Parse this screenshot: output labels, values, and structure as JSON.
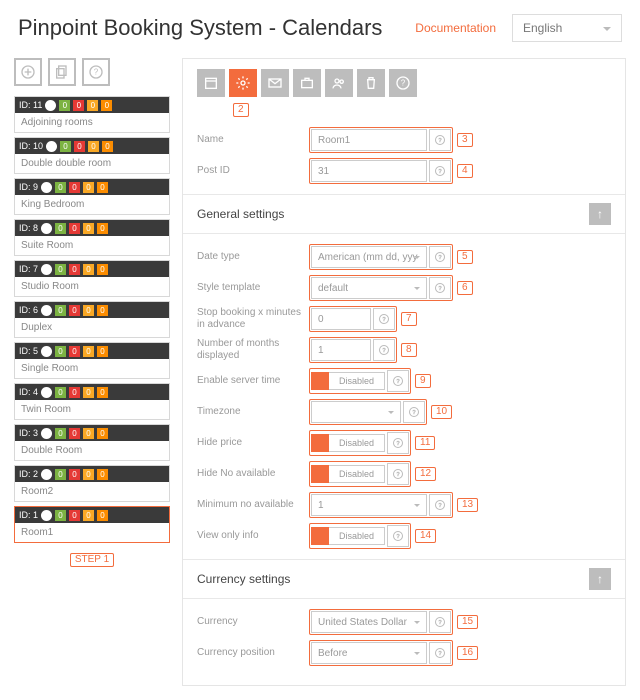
{
  "header": {
    "title": "Pinpoint Booking System - Calendars",
    "doc": "Documentation",
    "lang": "English"
  },
  "step1": "STEP 1",
  "toolbar_badge": "2",
  "calendars": [
    {
      "id": "ID: 11",
      "name": "Adjoining rooms"
    },
    {
      "id": "ID: 10",
      "name": "Double double room"
    },
    {
      "id": "ID: 9",
      "name": "King Bedroom"
    },
    {
      "id": "ID: 8",
      "name": "Suite Room"
    },
    {
      "id": "ID: 7",
      "name": "Studio Room"
    },
    {
      "id": "ID: 6",
      "name": "Duplex"
    },
    {
      "id": "ID: 5",
      "name": "Single Room"
    },
    {
      "id": "ID: 4",
      "name": "Twin Room"
    },
    {
      "id": "ID: 3",
      "name": "Double Room"
    },
    {
      "id": "ID: 2",
      "name": "Room2"
    },
    {
      "id": "ID: 1",
      "name": "Room1"
    }
  ],
  "stat_pill": "0",
  "labels": {
    "name": "Name",
    "postid": "Post ID",
    "general": "General settings",
    "datetype": "Date type",
    "style": "Style template",
    "stop": "Stop booking x minutes in advance",
    "months": "Number of months displayed",
    "server": "Enable server time",
    "tz": "Timezone",
    "hideprice": "Hide price",
    "hideno": "Hide No available",
    "minno": "Minimum no available",
    "viewonly": "View only info",
    "currency_sec": "Currency settings",
    "currency": "Currency",
    "curpos": "Currency position"
  },
  "values": {
    "name": "Room1",
    "postid": "31",
    "datetype": "American (mm dd, yyy",
    "style": "default",
    "stop": "0",
    "months": "1",
    "disabled": "Disabled",
    "minno": "1",
    "currency": "United States Dollar",
    "curpos": "Before"
  },
  "nums": {
    "name": "3",
    "postid": "4",
    "datetype": "5",
    "style": "6",
    "stop": "7",
    "months": "8",
    "server": "9",
    "tz": "10",
    "hideprice": "11",
    "hideno": "12",
    "minno": "13",
    "viewonly": "14",
    "currency": "15",
    "curpos": "16"
  }
}
